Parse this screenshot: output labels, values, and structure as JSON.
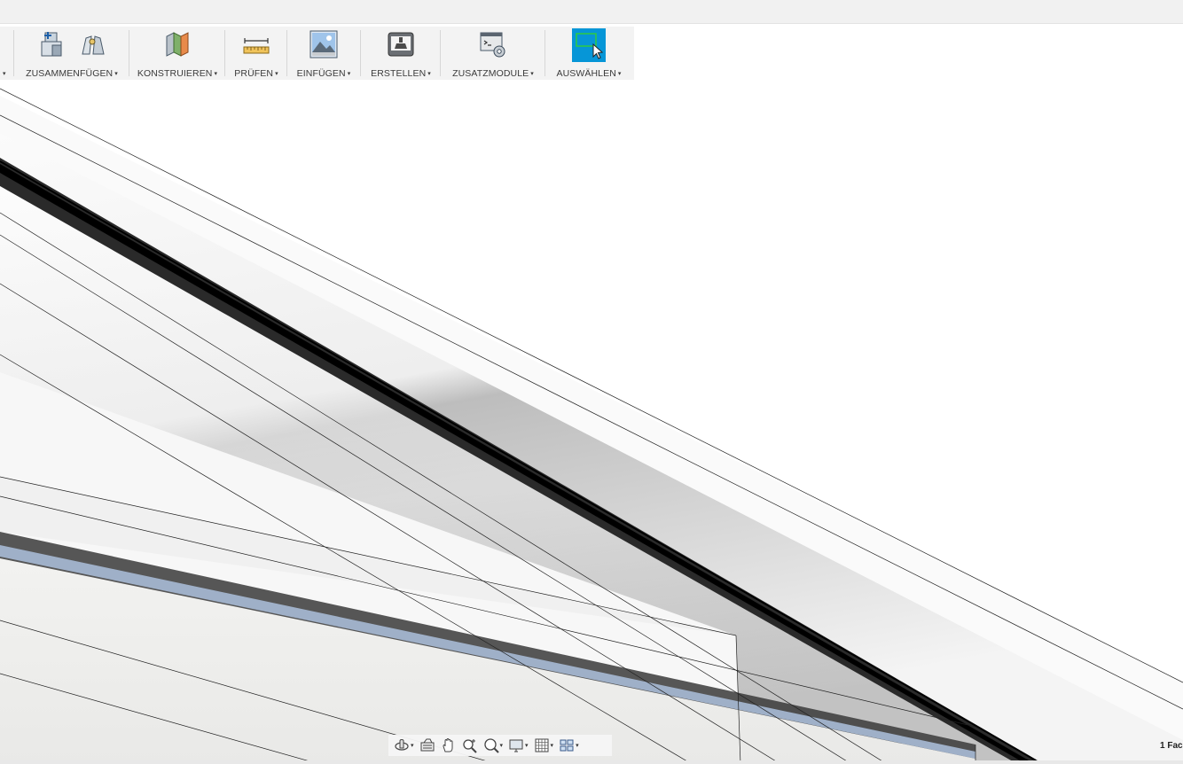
{
  "toolbar": {
    "groups": [
      {
        "label": "ZUSAMMENFÜGEN",
        "icons": [
          "new-component-icon",
          "joint-icon"
        ]
      },
      {
        "label": "KONSTRUIEREN",
        "icons": [
          "construct-plane-icon"
        ]
      },
      {
        "label": "PRÜFEN",
        "icons": [
          "measure-ruler-icon"
        ]
      },
      {
        "label": "EINFÜGEN",
        "icons": [
          "insert-image-icon"
        ]
      },
      {
        "label": "ERSTELLEN",
        "icons": [
          "print-3d-icon"
        ]
      },
      {
        "label": "ZUSATZMODULE",
        "icons": [
          "scripts-addins-icon"
        ]
      },
      {
        "label": "AUSWÄHLEN",
        "icons": [
          "select-window-icon"
        ]
      }
    ],
    "dropdown_caret": "▾",
    "accent_color": "#0696d7"
  },
  "navbar": {
    "items": [
      "orbit-icon",
      "look-at-icon",
      "pan-hand-icon",
      "zoom-icon",
      "fit-zoom-icon",
      "display-settings-icon",
      "grid-icon",
      "viewports-icon"
    ]
  },
  "status": {
    "text": "1 Fac"
  }
}
